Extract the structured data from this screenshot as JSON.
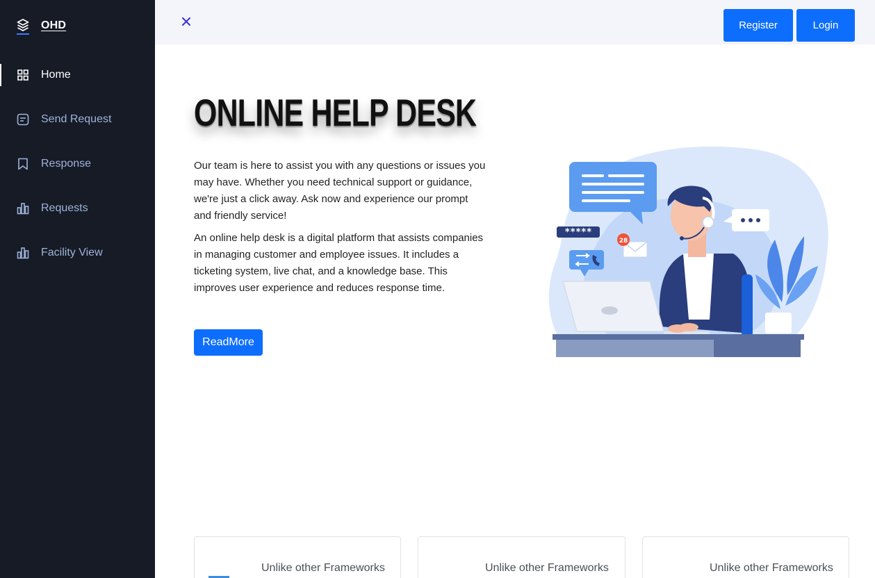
{
  "brand": {
    "name": "OHD"
  },
  "sidebar": {
    "items": [
      {
        "label": "Home",
        "icon": "grid-icon",
        "active": true
      },
      {
        "label": "Send Request",
        "icon": "message-square-icon",
        "active": false
      },
      {
        "label": "Response",
        "icon": "bookmark-icon",
        "active": false
      },
      {
        "label": "Requests",
        "icon": "bar-chart-icon",
        "active": false
      },
      {
        "label": "Facility View",
        "icon": "bar-chart-icon",
        "active": false
      }
    ]
  },
  "topbar": {
    "close_icon": "close-icon",
    "register_label": "Register",
    "login_label": "Login"
  },
  "hero": {
    "title": "ONLINE HELP DESK",
    "paragraph_1": "Our team is here to assist you with any questions or issues you may have. Whether you need technical support or guidance, we're just a click away. Ask now and experience our prompt and friendly service!",
    "paragraph_2": "An online help desk is a digital platform that assists companies in managing customer and employee issues. It includes a ticketing system, live chat, and a knowledge base. This improves user experience and reduces response time.",
    "button_label": "ReadMore",
    "illustration": {
      "password_text": "*****",
      "badge_count": "28"
    }
  },
  "cards": [
    {
      "title": "Unlike other Frameworks"
    },
    {
      "title": "Unlike other Frameworks"
    },
    {
      "title": "Unlike other Frameworks"
    }
  ],
  "colors": {
    "sidebar_bg": "#161b26",
    "accent": "#0d6efd",
    "topbar_bg": "#f4f5fa",
    "nav_text": "#9fb3d8"
  }
}
